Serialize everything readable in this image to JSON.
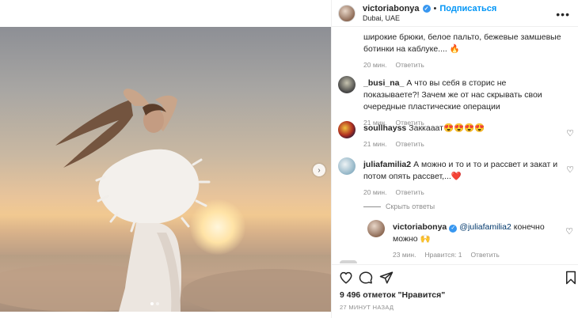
{
  "post": {
    "username": "victoriabonya",
    "verified_mark": "✓",
    "separator": "•",
    "follow_label": "Подписаться",
    "location": "Dubai, UAE",
    "more_label": "•••"
  },
  "photo": {
    "carousel_next": "›",
    "dots_count": 2
  },
  "comments": {
    "caption_tail": {
      "text": "широкие брюки, белое пальто, бежевые замшевые ботинки на каблуке.... 🔥",
      "time": "20 мин.",
      "reply": "Ответить"
    },
    "items": [
      {
        "username": "_busi_na_",
        "text": "А что вы себя в сторис не показываете?! Зачем же от нас скрывать свои очередные пластические операции",
        "time": "21 мин.",
        "reply": "Ответить"
      },
      {
        "username": "soullhayss",
        "text": "Заккааат😍😍😍😍",
        "time": "21 мин.",
        "reply": "Ответить"
      },
      {
        "username": "juliafamilia2",
        "text": "А можно и то и то и рассвет и закат и потом опять рассвет,...❤️",
        "time": "20 мин.",
        "reply": "Ответить"
      }
    ],
    "hide_replies": "Скрыть ответы",
    "reply_item": {
      "username": "victoriabonya",
      "mention": "@juliafamilia2",
      "text": " конечно можно 🙌",
      "time": "23 мин.",
      "likes": "Нравится: 1",
      "reply": "Ответить"
    },
    "heart_icon": "♡"
  },
  "footer": {
    "likes_text": "9 496 отметок \"Нравится\"",
    "time_ago": "27 МИНУТ НАЗАД"
  },
  "colors": {
    "link_blue": "#0095f6",
    "muted": "#8e8e8e",
    "text": "#262626"
  }
}
